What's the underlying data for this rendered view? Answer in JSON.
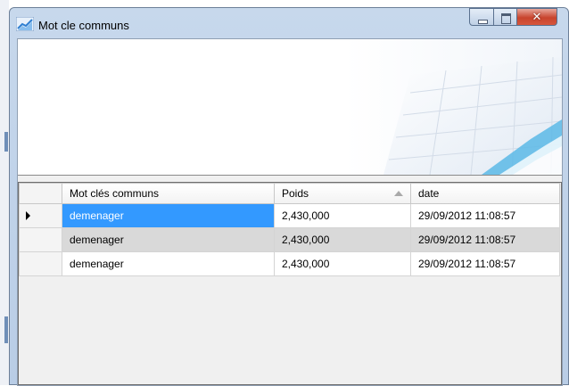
{
  "window": {
    "title": "Mot cle communs"
  },
  "grid": {
    "columns": [
      {
        "label": "Mot clés communs"
      },
      {
        "label": "Poids",
        "sorted": "ascending"
      },
      {
        "label": "date"
      }
    ],
    "rows": [
      {
        "mot": "demenager",
        "poids": "2,430,000",
        "date": "29/09/2012 11:08:57",
        "current": true
      },
      {
        "mot": "demenager",
        "poids": "2,430,000",
        "date": "29/09/2012 11:08:57"
      },
      {
        "mot": "demenager",
        "poids": "2,430,000",
        "date": "29/09/2012 11:08:57"
      }
    ]
  },
  "colors": {
    "selection": "#3399ff",
    "alt_row": "#d9d9d9",
    "close_button": "#c8442d"
  }
}
